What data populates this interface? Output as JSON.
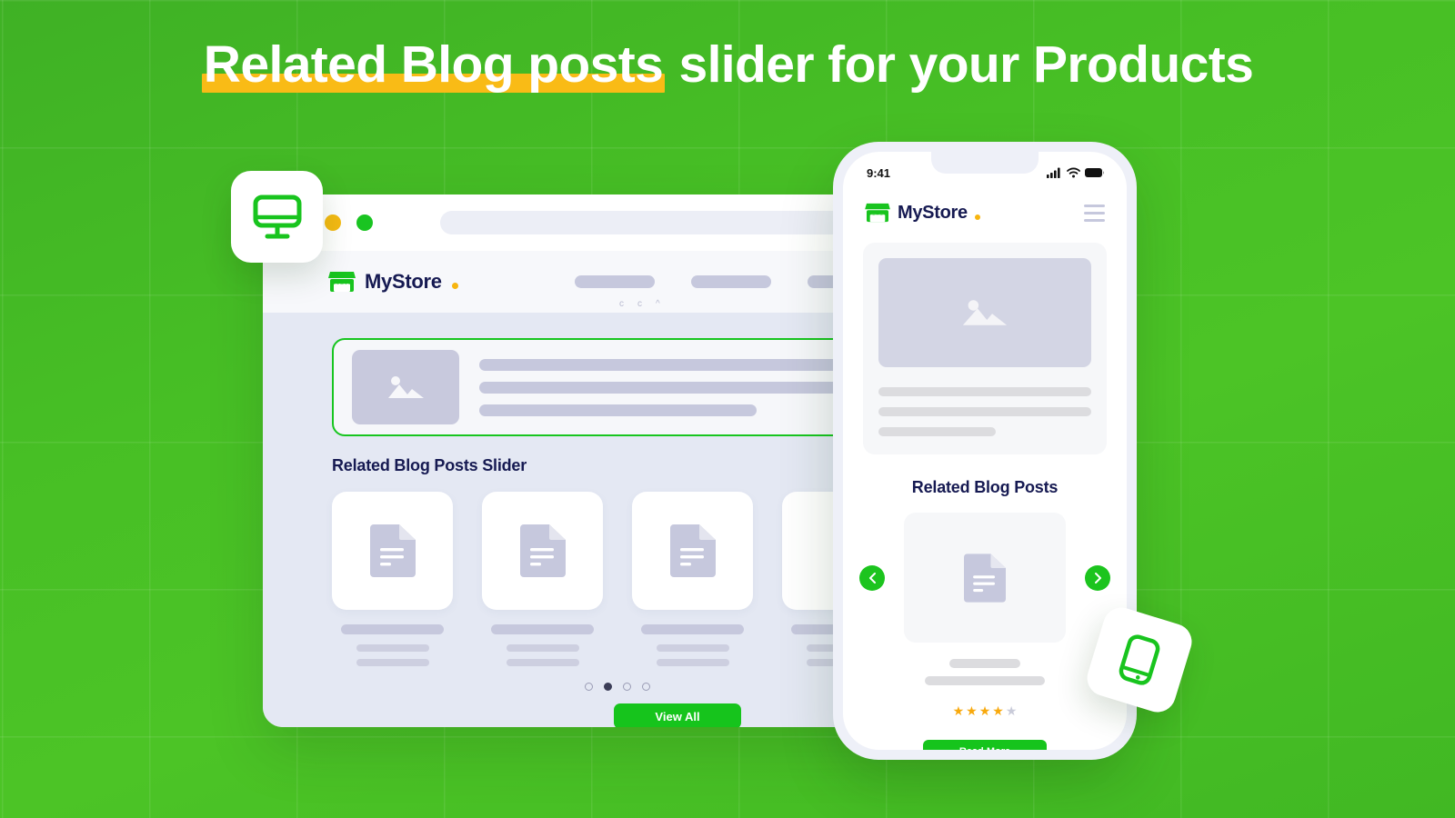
{
  "headline": {
    "highlighted": "Related Blog posts",
    "rest": " slider for your Products",
    "highlight_color": "#f9bb16"
  },
  "theme": {
    "background_green": "#47bf25",
    "accent_green": "#16c41c",
    "navy": "#161a52",
    "amber": "#f7b50f",
    "skeleton": "#c6c8dd"
  },
  "badges": {
    "desktop_icon": "monitor-icon",
    "mobile_icon": "mobile-phone-icon"
  },
  "desktop": {
    "window_dots": [
      {
        "name": "minimize-dot",
        "color": "#f5ba13"
      },
      {
        "name": "maximize-dot",
        "color": "#19c421"
      }
    ],
    "url_placeholder": "",
    "brand": {
      "name": "MyStore",
      "dot": "."
    },
    "nav_items": [
      "",
      "",
      ""
    ],
    "nav_sub": [
      "c",
      "c",
      "^"
    ],
    "product": {
      "image_icon": "image-placeholder-icon",
      "lines": [
        "",
        "",
        ""
      ]
    },
    "slider_title": "Related Blog Posts Slider",
    "blog_cards": [
      {
        "icon": "document-icon"
      },
      {
        "icon": "document-icon"
      },
      {
        "icon": "document-icon"
      },
      {
        "icon": "document-icon"
      }
    ],
    "pagination": {
      "count": 4,
      "active_index": 1
    },
    "view_all_label": "View All"
  },
  "mobile": {
    "status": {
      "time": "9:41",
      "icons": [
        "cellular-signal-icon",
        "wifi-icon",
        "battery-icon"
      ]
    },
    "brand": {
      "name": "MyStore",
      "dot": "."
    },
    "menu_icon": "hamburger-menu-icon",
    "product": {
      "image_icon": "image-placeholder-icon",
      "lines": [
        "",
        "",
        ""
      ]
    },
    "section_title": "Related Blog Posts",
    "slide": {
      "icon": "document-icon"
    },
    "prev_label": "‹",
    "next_label": "›",
    "rating": {
      "filled": 4,
      "total": 5
    },
    "read_more_label": "Read More"
  }
}
